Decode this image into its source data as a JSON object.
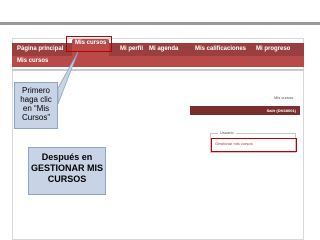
{
  "nav": {
    "items": [
      {
        "label": "Página principal"
      },
      {
        "label": "Mis cursos"
      },
      {
        "label": "Mi perfil"
      },
      {
        "label": "Mi agenda"
      },
      {
        "label": "Mis calificaciones"
      },
      {
        "label": "Mi progreso"
      }
    ]
  },
  "subnav": {
    "label": "Mis cursos"
  },
  "page": {
    "top_right_link": "Mis cursos",
    "logout_text": "Salir (DK68001)",
    "user_block_title": "Usuario",
    "user_block_link": "Gestionar mis cursos"
  },
  "callouts": {
    "first": [
      "Primero",
      "haga clic",
      "en  “Mis",
      "Cursos”"
    ],
    "second": [
      "Después en",
      "GESTIONAR MIS",
      "CURSOS"
    ]
  },
  "colors": {
    "nav": "#9a3f3f",
    "nav_active": "#b94a4a",
    "highlight": "#c00000",
    "callout_bg": "#c8d3e6"
  }
}
